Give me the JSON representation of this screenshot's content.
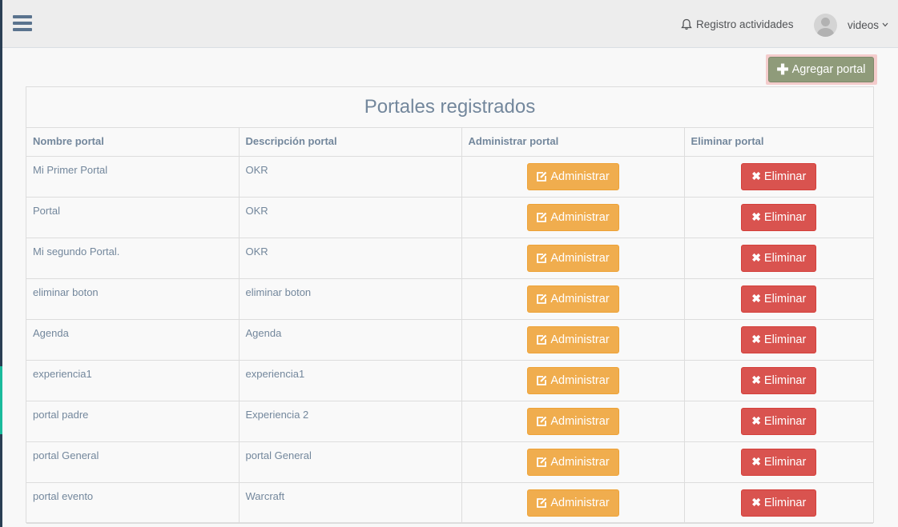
{
  "header": {
    "activity_label": "Registro actividades",
    "username": "videos"
  },
  "actions": {
    "add_portal_label": "Agregar portal"
  },
  "table": {
    "title": "Portales registrados",
    "columns": [
      "Nombre portal",
      "Descripción portal",
      "Administrar portal",
      "Eliminar portal"
    ],
    "admin_label": "Administrar",
    "delete_label": "Eliminar",
    "rows": [
      {
        "name": "Mi Primer Portal",
        "description": "OKR"
      },
      {
        "name": "Portal",
        "description": "OKR"
      },
      {
        "name": "Mi segundo Portal.",
        "description": "OKR"
      },
      {
        "name": "eliminar boton",
        "description": "eliminar boton"
      },
      {
        "name": "Agenda",
        "description": "Agenda"
      },
      {
        "name": "experiencia1",
        "description": "experiencia1"
      },
      {
        "name": "portal padre",
        "description": "Experiencia 2"
      },
      {
        "name": "portal General",
        "description": "portal General"
      },
      {
        "name": "portal evento",
        "description": "Warcraft"
      }
    ]
  },
  "icons": {
    "menu": "hamburger-icon",
    "activity": "bell-icon",
    "user": "user-avatar-icon",
    "dropdown": "chevron-down-icon",
    "add": "plus-icon",
    "admin": "edit-icon",
    "delete": "times-icon"
  },
  "colors": {
    "sidebar": "#2a3f54",
    "sidebar_accent": "#1abb9c",
    "add_button": "#8f9b7a",
    "admin_button": "#f0ad4e",
    "delete_button": "#d9534f",
    "text": "#73879c"
  }
}
